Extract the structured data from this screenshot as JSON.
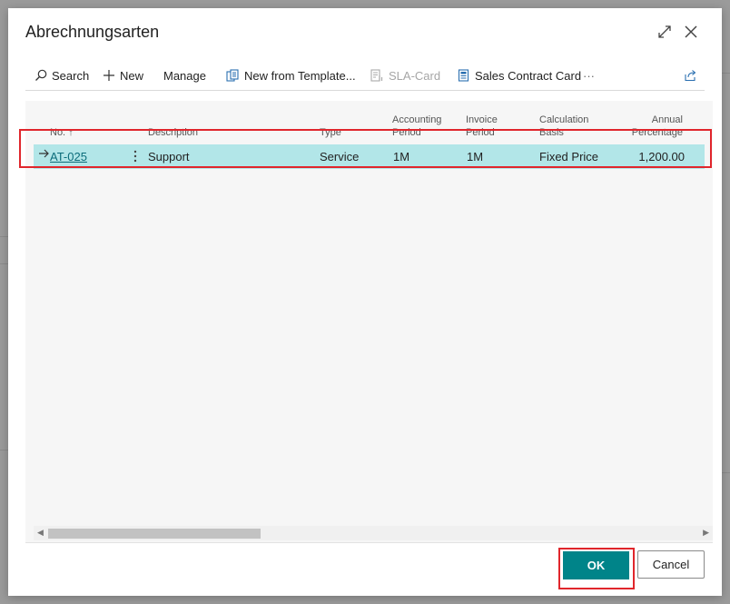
{
  "dialog": {
    "title": "Abrechnungsarten"
  },
  "toolbar": {
    "search_label": "Search",
    "new_label": "New",
    "manage_label": "Manage",
    "new_from_template_label": "New from Template...",
    "sla_card_label": "SLA-Card",
    "sales_contract_card_label": "Sales Contract Card",
    "more_label": "···"
  },
  "table": {
    "columns": {
      "no_label": "No.",
      "sort_arrow": "↑",
      "description_label": "Description",
      "type_label": "Type",
      "accounting_period_line1": "Accounting",
      "accounting_period_line2": "Period",
      "invoice_period_line1": "Invoice",
      "invoice_period_line2": "Period",
      "calculation_basis_line1": "Calculation",
      "calculation_basis_line2": "Basis",
      "annual_percentage_line1": "Annual",
      "annual_percentage_line2": "Percentage"
    },
    "rows": [
      {
        "no": "AT-025",
        "description": "Support",
        "type": "Service",
        "accounting_period": "1M",
        "invoice_period": "1M",
        "calculation_basis": "Fixed Price",
        "annual_percentage": "1,200.00"
      }
    ]
  },
  "footer": {
    "ok_label": "OK",
    "cancel_label": "Cancel"
  },
  "colors": {
    "accent": "#008489",
    "selected_row": "#b2e6e8",
    "highlight_border": "#e0262c",
    "link": "#0b6c7a"
  }
}
